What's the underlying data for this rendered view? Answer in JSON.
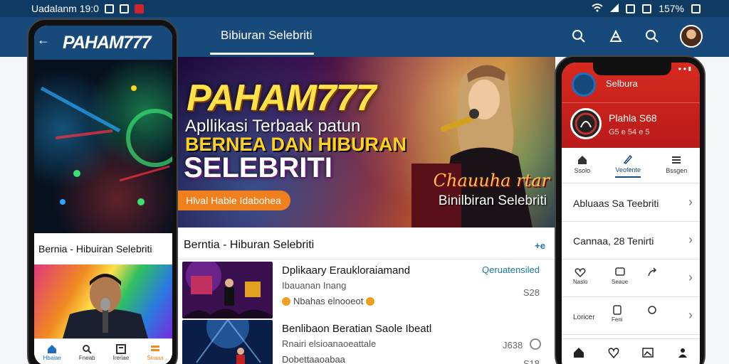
{
  "status_bar": {
    "time_text": "Uadalanm 19:0",
    "battery": "157%"
  },
  "app_bar": {
    "title": "Bibiuran Selebriti"
  },
  "banner": {
    "brand": "PAHAM777",
    "line1": "Apllikasi Terbaak patun",
    "line2": "BERNEA DAN HIBURAN",
    "line3": "SELEBRITI",
    "pill": "Hlval Hable Idabohea",
    "caption_script": "Chauuha rtar",
    "caption": "Binilbiran Selebriti"
  },
  "content": {
    "section_title": "Berntia - Hiburan Selebriti",
    "section_icon": "+e",
    "items": [
      {
        "title": "Dplikaary Eraukloraiamand",
        "subtitle": "Ibauanan Inang",
        "meta": "Nbahas elnooeot",
        "tag": "Qeruatensiled",
        "number": "S28"
      },
      {
        "title": "Benlibaon Beratian Saole Ibeatl",
        "subtitle": "Rnairi elsioanaoeattale",
        "meta": "Dobettaaoabaa",
        "count": "J638",
        "number": "S18"
      }
    ]
  },
  "left_phone": {
    "logo": "PAHAM777",
    "caption": "Bernia - Hibuiran Selebriti",
    "nav": [
      "Hbaiae",
      "Fneab",
      "Ireriae",
      "Seaaa"
    ]
  },
  "right_phone": {
    "app_name": "Selbura",
    "profile_name": "Plahla S68",
    "profile_sub": "G5 e 54 e 5",
    "tabs": [
      "Ssolo",
      "Veofente",
      "Bssgen"
    ],
    "rows": [
      {
        "label": "Abluaas Sa Teebriti"
      },
      {
        "label": "Cannaa, 28 Tenirti"
      }
    ],
    "mini_row_1": [
      "Naslo",
      "Seaue"
    ],
    "mini_row_2_label": "Loricer",
    "mini_row_2": [
      "Feni"
    ]
  },
  "colors": {
    "primary": "#17497a",
    "accent": "#ffd21e",
    "red": "#d82a1e",
    "orange": "#f0801e"
  }
}
